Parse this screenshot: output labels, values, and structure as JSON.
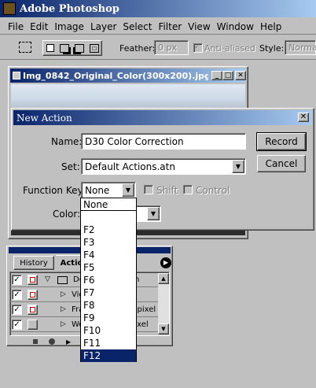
{
  "app": {
    "title": "Adobe Photoshop"
  },
  "menu": [
    "File",
    "Edit",
    "Image",
    "Layer",
    "Select",
    "Filter",
    "View",
    "Window",
    "Help"
  ],
  "options": {
    "feather_label": "Feather:",
    "feather_value": "0 px",
    "antialiased_label": "Anti-aliased",
    "style_label": "Style:",
    "style_value": "Normal"
  },
  "doc": {
    "title": "Img_0842_Original_Color(300x200).jpg @ ..."
  },
  "dialog": {
    "title": "New Action",
    "name_label": "Name:",
    "name_value": "D30 Color Correction",
    "set_label": "Set:",
    "set_value": "Default Actions.atn",
    "fkey_label": "Function Key:",
    "fkey_value": "None",
    "shift_label": "Shift",
    "control_label": "Control",
    "color_label": "Color:",
    "record_label": "Record",
    "cancel_label": "Cancel"
  },
  "fkey_list": [
    "None",
    "F2",
    "F3",
    "F4",
    "F5",
    "F6",
    "F7",
    "F8",
    "F9",
    "F10",
    "F11",
    "F12"
  ],
  "fkey_selected": "F12",
  "panel": {
    "tab_history": "History",
    "tab_actions": "Actio",
    "rows": [
      {
        "label": "De",
        "trailing": "n"
      },
      {
        "label": "Vig",
        "trailing": ""
      },
      {
        "label": "Fra",
        "trailing": "0 pixel"
      },
      {
        "label": "Wo",
        "trailing": "pixel"
      }
    ]
  }
}
